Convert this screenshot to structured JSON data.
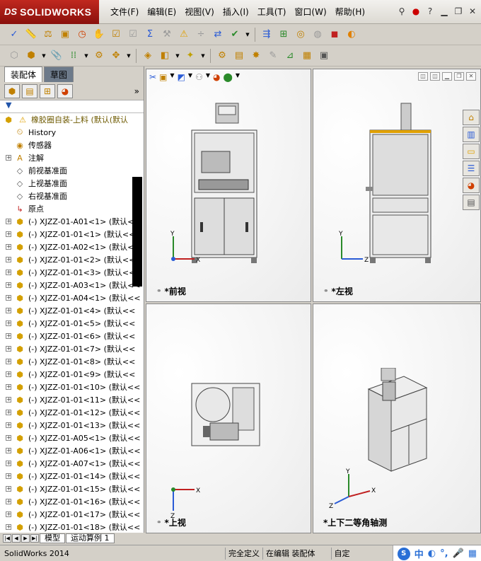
{
  "app": {
    "logo_ds": "DS",
    "logo_name": "SOLIDWORKS"
  },
  "menu": [
    {
      "label": "文件(F)"
    },
    {
      "label": "编辑(E)"
    },
    {
      "label": "视图(V)"
    },
    {
      "label": "插入(I)"
    },
    {
      "label": "工具(T)"
    },
    {
      "label": "窗口(W)"
    },
    {
      "label": "帮助(H)"
    }
  ],
  "panel_tabs": {
    "assembly": "装配体",
    "sketch": "草图"
  },
  "tree": {
    "root": "橡胶圈自装-上料  (默认(默认",
    "features": [
      {
        "label": "History",
        "icon": "history-icon"
      },
      {
        "label": "传感器",
        "icon": "sensor-icon"
      },
      {
        "label": "注解",
        "icon": "annotation-icon"
      },
      {
        "label": "前视基准面",
        "icon": "plane-icon"
      },
      {
        "label": "上视基准面",
        "icon": "plane-icon"
      },
      {
        "label": "右视基准面",
        "icon": "plane-icon"
      },
      {
        "label": "原点",
        "icon": "origin-icon"
      }
    ],
    "components": [
      "(-) XJZZ-01-A01<1>  (默认<<",
      "(-) XJZZ-01-01<1>  (默认<<",
      "(-) XJZZ-01-A02<1>  (默认<<",
      "(-) XJZZ-01-01<2>  (默认<<",
      "(-) XJZZ-01-01<3>  (默认<<",
      "(-) XJZZ-01-A03<1>  (默认<<",
      "(-) XJZZ-01-A04<1>  (默认<<",
      "(-) XJZZ-01-01<4>  (默认<<",
      "(-) XJZZ-01-01<5>  (默认<<",
      "(-) XJZZ-01-01<6>  (默认<<",
      "(-) XJZZ-01-01<7>  (默认<<",
      "(-) XJZZ-01-01<8>  (默认<<",
      "(-) XJZZ-01-01<9>  (默认<<",
      "(-) XJZZ-01-01<10>  (默认<<",
      "(-) XJZZ-01-01<11>  (默认<<",
      "(-) XJZZ-01-01<12>  (默认<<",
      "(-) XJZZ-01-01<13>  (默认<<",
      "(-) XJZZ-01-A05<1>  (默认<<",
      "(-) XJZZ-01-A06<1>  (默认<<",
      "(-) XJZZ-01-A07<1>  (默认<<",
      "(-) XJZZ-01-01<14>  (默认<<",
      "(-) XJZZ-01-01<15>  (默认<<",
      "(-) XJZZ-01-01<16>  (默认<<",
      "(-) XJZZ-01-01<17>  (默认<<",
      "(-) XJZZ-01-01<18>  (默认<<"
    ]
  },
  "bottom_tabs": {
    "model": "模型",
    "motion": "运动算例 1"
  },
  "viewports": {
    "front": "*前视",
    "left": "*左视",
    "top": "*上视",
    "iso": "*上下二等角轴测"
  },
  "status": {
    "app": "SolidWorks 2014",
    "defined": "完全定义",
    "editing": "在编辑 装配体",
    "custom": "自定"
  },
  "axes": {
    "x": "X",
    "y": "Y",
    "z": "Z"
  }
}
